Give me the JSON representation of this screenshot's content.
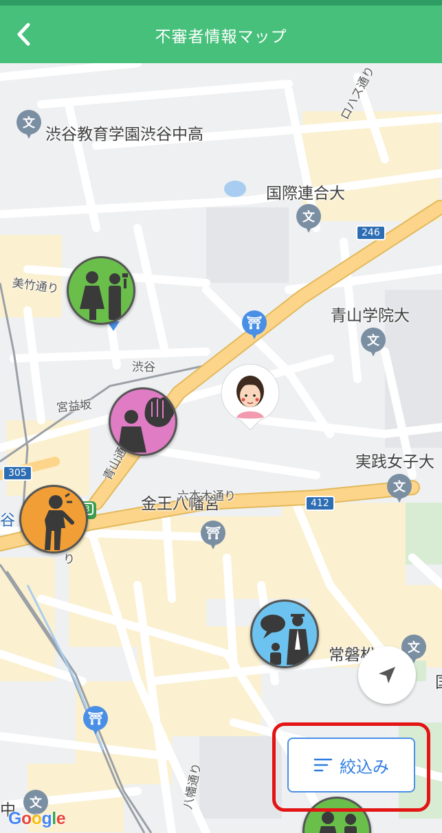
{
  "header": {
    "title": "不審者情報マップ",
    "back_icon": "chevron-left-icon"
  },
  "colors": {
    "header_bg": "#46c07b",
    "filter_accent": "#2f7de1",
    "highlight": "#e31414"
  },
  "map": {
    "places": {
      "shibuya_school": "渋谷教育学園渋谷中高",
      "kokusai_rengo": "国際連合大",
      "aoyama_gakuin": "青山学院大",
      "jissen_joshi": "実践女子大",
      "tokiwamatsu": "常磐松小",
      "bottom_school": "中"
    },
    "streets": {
      "mitake": "美竹通り",
      "loharu": "ロハス通り",
      "shibuya": "渋谷",
      "miyamasuzaka": "宮益坂",
      "aoyama": "青山通",
      "konno": "金王八幡宮",
      "roppongi": "六本木通り",
      "hachiman": "八幡通り",
      "ri": "り",
      "tani": "谷",
      "kuni": "国"
    },
    "route_shields": [
      "246",
      "305",
      "412",
      "3"
    ],
    "markers": [
      {
        "type": "loitering",
        "color": "#6abf4b"
      },
      {
        "type": "grabbing",
        "color": "#e07cc4"
      },
      {
        "type": "suspicious-behavior",
        "color": "#f09e35"
      },
      {
        "type": "talking-stranger",
        "color": "#6cc3ef"
      },
      {
        "type": "loitering-bottom",
        "color": "#6abf4b"
      }
    ]
  },
  "controls": {
    "locate_icon": "navigation-arrow-icon",
    "filter_label": "絞込み",
    "filter_icon": "filter-lines-icon"
  },
  "attribution": {
    "google_letters": [
      "G",
      "o",
      "o",
      "g",
      "l",
      "e"
    ]
  }
}
